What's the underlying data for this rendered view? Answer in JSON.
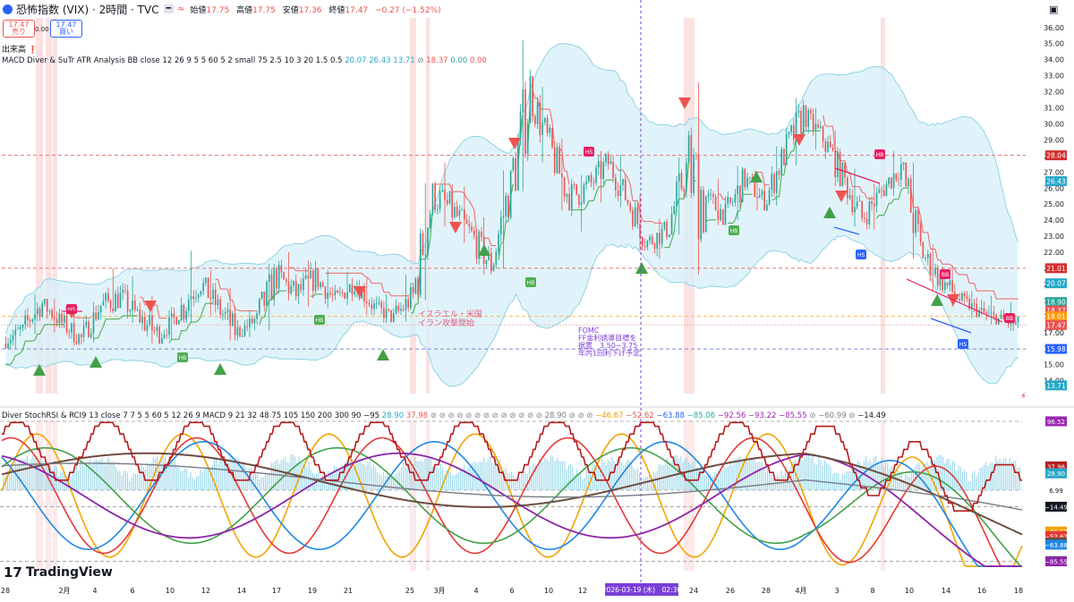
{
  "header": {
    "title": "恐怖指数 (VIX) · 2時間 · TVC",
    "open_label": "始値",
    "open": "17.75",
    "high_label": "高値",
    "high": "17.75",
    "low_label": "安値",
    "low": "17.36",
    "close_label": "終値",
    "close": "17.47",
    "change": "−0.27 (−1.52%)"
  },
  "trade": {
    "sell_price": "17.47",
    "sell_label": "売り",
    "spread": "0.00",
    "buy_price": "17.47",
    "buy_label": "買い"
  },
  "volume_label": "出来高",
  "indicator1": {
    "text": "MACD Diver & SuTr ATR Analysis BB close 12 26 9 5 5 60 5 2 small 75 2.5 10 3 20 1.5 0.5",
    "values": [
      "20.07",
      "26.43",
      "13.71",
      "⊘",
      "18.37",
      "0.00",
      "0.00"
    ]
  },
  "indicator2": {
    "text": "Diver StochRSI & RCI9 13 close 7 7 5 5 60 5 12 26 9 MACD 9 21 32 48 75 105 150 200 300 90 −95",
    "values": [
      "28.90",
      "37.98",
      "⊘ ⊘ ⊘ ⊘ ⊘ ⊘ ⊘ ⊘ ⊘ ⊘ ⊘ ⊘ ⊘",
      "28.90",
      "⊘ ⊘ ⊘",
      "−46.67",
      "−52.62",
      "−63.88",
      "−85.06",
      "−92.56",
      "−93.22",
      "−85.55",
      "⊘",
      "−60.99",
      "⊘",
      "−14.49"
    ]
  },
  "annotations": {
    "event1": [
      "イスラエル・米国",
      "イラン攻撃開始"
    ],
    "event2": [
      "FOMC",
      "FF金利誘導目標を",
      "据置　3.50−3.75",
      "年内1回利下げ予定"
    ]
  },
  "logo": "TradingView",
  "date_tag": "2026-03-19 (木)　02:30",
  "colors": {
    "up": "#26a69a",
    "down": "#ef5350",
    "bb_fill": "#d7eff8",
    "bb_line": "#8fd3e6",
    "trail_red": "#ef6f6f",
    "trail_green": "#4caf50",
    "vline": "#7b3fd9"
  },
  "chart_data": [
    {
      "type": "candlestick",
      "title": "恐怖指数 (VIX) · 2時間 · TVC",
      "y_ticks": [
        "36.00",
        "35.00",
        "34.00",
        "33.00",
        "32.00",
        "31.00",
        "30.00",
        "29.00",
        "28.00",
        "27.00",
        "26.00",
        "25.00",
        "24.00",
        "23.00",
        "22.00",
        "21.00",
        "20.00",
        "19.00",
        "18.00",
        "17.00",
        "16.00",
        "15.00",
        "14.00"
      ],
      "ylim": [
        13.2,
        36.6
      ],
      "x_ticks": [
        "28",
        "2月",
        "4",
        "6",
        "10",
        "12",
        "14",
        "17",
        "19",
        "21",
        "25",
        "3月",
        "4",
        "6",
        "10",
        "12",
        "14",
        "2026-03-19 (木)　02:30",
        "24",
        "26",
        "28",
        "4月",
        "3",
        "8",
        "10",
        "14",
        "16",
        "18"
      ],
      "price_tags": [
        {
          "label": "28.04",
          "value": 28.04,
          "color": "#d32f2f"
        },
        {
          "label": "26.43",
          "value": 26.43,
          "color": "#26a8c7"
        },
        {
          "label": "21.01",
          "value": 21.01,
          "color": "#d32f2f"
        },
        {
          "label": "20.07",
          "value": 20.07,
          "color": "#26a8c7"
        },
        {
          "label": "18.90",
          "value": 18.9,
          "color": "#26a69a"
        },
        {
          "label": "18.37",
          "value": 18.37,
          "color": "#ef5350"
        },
        {
          "label": "18.01",
          "value": 18.01,
          "color": "#ff9800"
        },
        {
          "label": "17.47",
          "value": 17.47,
          "color": "#ef5350"
        },
        {
          "label": "15.98",
          "value": 15.98,
          "color": "#2962ff"
        },
        {
          "label": "13.71",
          "value": 13.71,
          "color": "#26a8c7"
        }
      ],
      "hlines": [
        28.04,
        21.01,
        18.01,
        15.98
      ],
      "ohlc_anchor": [
        [
          16.3,
          17.5,
          16.0,
          17.3
        ],
        [
          17.3,
          19.4,
          16.9,
          18.8
        ],
        [
          18.8,
          19.1,
          17.0,
          17.6
        ],
        [
          17.6,
          18.5,
          16.2,
          16.6
        ],
        [
          16.6,
          18.9,
          16.4,
          18.7
        ],
        [
          18.7,
          21.0,
          18.2,
          19.2
        ],
        [
          19.2,
          20.5,
          17.6,
          17.9
        ],
        [
          17.9,
          19.3,
          16.3,
          16.8
        ],
        [
          16.8,
          18.6,
          16.6,
          18.2
        ],
        [
          18.2,
          22.1,
          17.6,
          20.3
        ],
        [
          20.3,
          20.9,
          18.1,
          18.6
        ],
        [
          18.6,
          19.8,
          16.5,
          16.9
        ],
        [
          16.9,
          18.4,
          16.7,
          17.9
        ],
        [
          17.9,
          21.3,
          17.1,
          20.6
        ],
        [
          20.6,
          22.0,
          19.0,
          19.4
        ],
        [
          19.4,
          21.5,
          18.6,
          20.4
        ],
        [
          20.4,
          20.9,
          18.5,
          19.0
        ],
        [
          19.0,
          20.8,
          18.7,
          20.1
        ],
        [
          20.1,
          20.4,
          18.1,
          18.6
        ],
        [
          18.6,
          19.4,
          17.6,
          17.9
        ],
        [
          17.9,
          20.6,
          17.7,
          19.3
        ],
        [
          19.3,
          26.3,
          19.0,
          25.6
        ],
        [
          25.6,
          27.6,
          23.6,
          24.6
        ],
        [
          24.6,
          26.1,
          22.6,
          23.0
        ],
        [
          23.0,
          24.2,
          20.6,
          21.2
        ],
        [
          21.2,
          27.1,
          21.0,
          26.3
        ],
        [
          26.3,
          35.2,
          25.8,
          31.9
        ],
        [
          31.9,
          32.3,
          27.6,
          28.5
        ],
        [
          28.5,
          29.1,
          24.6,
          25.4
        ],
        [
          25.4,
          26.8,
          23.3,
          26.1
        ],
        [
          26.1,
          28.3,
          25.1,
          27.6
        ],
        [
          27.6,
          28.1,
          24.8,
          25.2
        ],
        [
          25.2,
          25.6,
          22.1,
          22.6
        ],
        [
          22.6,
          24.1,
          21.6,
          23.4
        ],
        [
          23.4,
          27.9,
          23.1,
          27.2
        ],
        [
          27.2,
          32.6,
          20.6,
          25.3
        ],
        [
          25.3,
          26.6,
          23.7,
          24.3
        ],
        [
          24.3,
          27.4,
          24.0,
          26.6
        ],
        [
          26.6,
          27.0,
          24.6,
          25.1
        ],
        [
          25.1,
          28.6,
          24.9,
          28.1
        ],
        [
          28.1,
          31.6,
          27.4,
          30.6
        ],
        [
          30.6,
          31.0,
          28.4,
          29.1
        ],
        [
          29.1,
          29.6,
          26.1,
          26.7
        ],
        [
          26.7,
          27.2,
          23.6,
          24.1
        ],
        [
          24.1,
          26.3,
          23.4,
          25.8
        ],
        [
          25.8,
          28.3,
          25.5,
          27.4
        ],
        [
          27.4,
          27.6,
          21.6,
          22.1
        ],
        [
          22.1,
          22.5,
          19.6,
          20.3
        ],
        [
          20.3,
          21.1,
          18.6,
          19.1
        ],
        [
          19.1,
          19.6,
          17.9,
          18.3
        ],
        [
          18.3,
          19.3,
          17.5,
          17.8
        ],
        [
          17.8,
          18.9,
          17.1,
          17.5
        ]
      ],
      "series": [
        {
          "name": "BB upper / lower",
          "values_at_start": [
            20.5,
            15.9
          ],
          "values_at_end": [
            26.4,
            13.7
          ]
        },
        {
          "name": "ATR trailing stop",
          "last": 18.37
        }
      ],
      "markers": {
        "sell_triangles": 12,
        "buy_triangles": 8,
        "labels": [
          "HS",
          "HB",
          "HB",
          "HB",
          "HS",
          "HB",
          "HB",
          "HS",
          "BB",
          "HS",
          "BB",
          "HS"
        ]
      }
    },
    {
      "type": "line",
      "title": "Diver StochRSI & RCI",
      "y_ticks": [
        "96.52",
        "6.99",
        "−14.49"
      ],
      "right_tags": [
        {
          "label": "96.52",
          "value": 96.52,
          "color": "#9c27b0"
        },
        {
          "label": "37.98",
          "value": 37.98,
          "color": "#b71c1c"
        },
        {
          "label": "28.90",
          "value": 28.9,
          "color": "#787b86"
        },
        {
          "label": "28.90",
          "value": 28.9,
          "color": "#26a8c7"
        },
        {
          "label": "6.99",
          "value": 6.99,
          "color": "#ffffff"
        },
        {
          "label": "−14.49",
          "value": -14.49,
          "color": "#131722"
        },
        {
          "label": "−46.67",
          "value": -46.67,
          "color": "#f4a300"
        },
        {
          "label": "−52.62",
          "value": -52.62,
          "color": "#e53935"
        },
        {
          "label": "−60.99",
          "value": -60.99,
          "color": "#6d4c41"
        },
        {
          "label": "−63.88",
          "value": -63.88,
          "color": "#1e88e5"
        },
        {
          "label": "−85.06",
          "value": -85.06,
          "color": "#43a047"
        },
        {
          "label": "−85.55",
          "value": -85.55,
          "color": "#8e24aa"
        }
      ],
      "ylim": [
        -100,
        100
      ]
    }
  ]
}
